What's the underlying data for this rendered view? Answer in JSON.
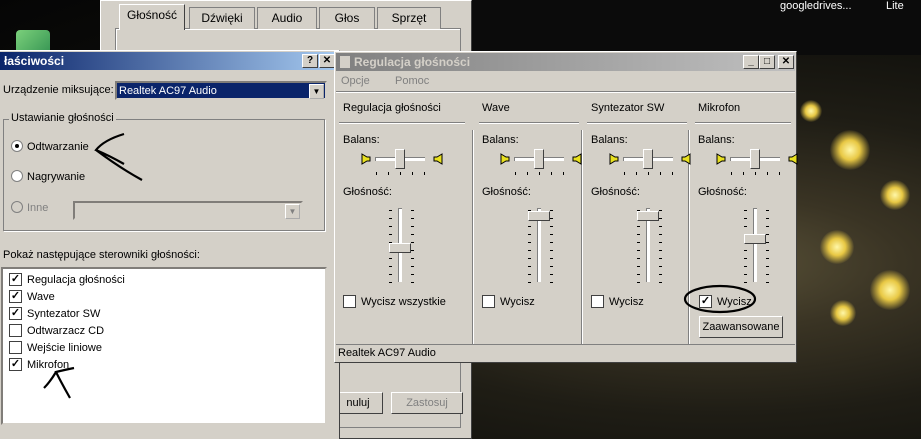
{
  "desktop": {
    "label1": "googledrives...",
    "label2": "Lite"
  },
  "sound_window": {
    "tabs": [
      "Głośność",
      "Dźwięki",
      "Audio",
      "Głos",
      "Sprzęt"
    ]
  },
  "props": {
    "title": "łaściwości",
    "mixer_label": "Urządzenie miksujące:",
    "mixer_value": "Realtek AC97 Audio",
    "group_label": "Ustawianie głośności",
    "radios": [
      "Odtwarzanie",
      "Nagrywanie",
      "Inne"
    ],
    "show_label": "Pokaż następujące sterowniki głośności:",
    "list": [
      {
        "label": "Regulacja głośności",
        "checked": true
      },
      {
        "label": "Wave",
        "checked": true
      },
      {
        "label": "Syntezator SW",
        "checked": true
      },
      {
        "label": "Odtwarzacz CD",
        "checked": false
      },
      {
        "label": "Wejście liniowe",
        "checked": false
      },
      {
        "label": "Mikrofon",
        "checked": true
      }
    ],
    "cancel_partial": "nuluj",
    "apply": "Zastosuj"
  },
  "mixer": {
    "title": "Regulacja głośności",
    "menu": [
      "Opcje",
      "Pomoc"
    ],
    "balance": "Balans:",
    "volume": "Głośność:",
    "channels": [
      {
        "name": "Regulacja głośności",
        "mute": "Wycisz wszystkie",
        "muted": false,
        "level": 0.45
      },
      {
        "name": "Wave",
        "mute": "Wycisz",
        "muted": false,
        "level": 0.95
      },
      {
        "name": "Syntezator SW",
        "mute": "Wycisz",
        "muted": false,
        "level": 0.95
      },
      {
        "name": "Mikrofon",
        "mute": "Wycisz",
        "muted": true,
        "level": 0.6
      }
    ],
    "advanced": "Zaawansowane",
    "status": "Realtek AC97 Audio"
  },
  "colors": {
    "title_active": "#0a246a",
    "title_inactive": "#808080",
    "face": "#d4d0c8"
  }
}
